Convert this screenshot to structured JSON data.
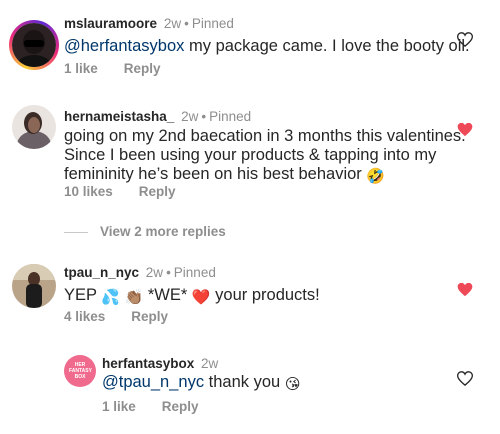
{
  "comments": [
    {
      "username": "mslauramoore",
      "time": "2w",
      "pinned": "Pinned",
      "mention": "@herfantasybox",
      "text": " my package came. I love the booty oil.",
      "likes": "1 like",
      "reply": "Reply",
      "liked": false
    },
    {
      "username": "hernameistasha_",
      "time": "2w",
      "pinned": "Pinned",
      "lines": [
        "going on my 2nd baecation in 3 months this valentines.",
        "Since I been using your products & tapping into my",
        "femininity he’s been on his best behavior"
      ],
      "emoji": "🤣",
      "likes": "10 likes",
      "reply": "Reply",
      "liked": true
    },
    {
      "username": "tpau_n_nyc",
      "time": "2w",
      "pinned": "Pinned",
      "text_start": "YEP",
      "emoji1": "💦",
      "emoji2": "👏🏽",
      "text_mid": "*WE*",
      "emoji3": "❤️",
      "text_end": "your products!",
      "likes": "4 likes",
      "reply": "Reply",
      "liked": true
    }
  ],
  "view_replies": "View 2 more replies",
  "reply": {
    "username": "herfantasybox",
    "time": "2w",
    "avatar_text": "HER FANTASY BOX",
    "mention": "@tpau_n_nyc",
    "text": " thank you",
    "emoji": "😘",
    "likes": "1 like",
    "reply": "Reply",
    "liked": false
  },
  "colors": {
    "heart_red": "#ed4956",
    "link_blue": "#00376b",
    "muted": "#8e8e8e",
    "brand_pink": "#f06a8d"
  },
  "icons": [
    "heart-outline-icon",
    "heart-filled-icon"
  ]
}
